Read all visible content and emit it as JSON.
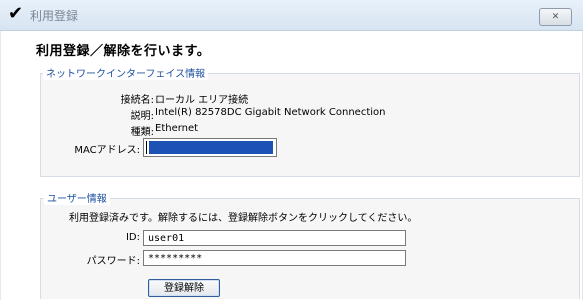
{
  "window": {
    "title": "利用登録",
    "app_icon": "check-mark-icon",
    "close_icon": "close-icon",
    "close_glyph": "✕"
  },
  "heading": "利用登録／解除を行います。",
  "network_info": {
    "legend": "ネットワークインターフェイス情報",
    "connection_name_label": "接続名:",
    "connection_name_value": "ローカル エリア接続",
    "description_label": "説明:",
    "description_value": "Intel(R) 82578DC Gigabit Network Connection",
    "type_label": "種類:",
    "type_value": "Ethernet",
    "mac_label": "MACアドレス:"
  },
  "user_info": {
    "legend": "ユーザー情報",
    "status_message": "利用登録済みです。解除するには、登録解除ボタンをクリックしてください。",
    "id_label": "ID:",
    "id_value": "user01",
    "password_label": "パスワード:",
    "password_value": "*********",
    "unregister_button": "登録解除"
  },
  "colors": {
    "legend_text": "#1e50a2",
    "redaction": "#1e51b4",
    "titlebar_top": "#e9f1fa",
    "titlebar_bottom": "#d6e4f2"
  }
}
